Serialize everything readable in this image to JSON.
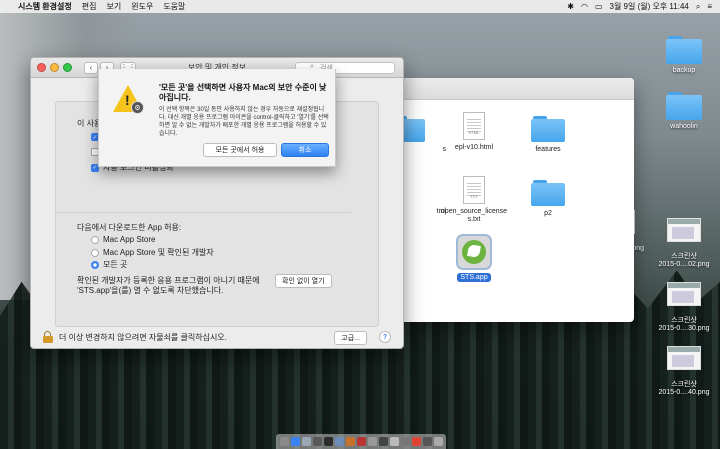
{
  "menubar": {
    "app_name": "시스템 환경설정",
    "items": [
      "편집",
      "보기",
      "윈도우",
      "도움말"
    ],
    "clock": "3월 9일 (월) 오후 11:44",
    "icons": [
      "apple-icon",
      "bluetooth-icon",
      "wifi-icon",
      "battery-icon",
      "spotlight-icon",
      "notification-icon"
    ]
  },
  "prefs": {
    "title": "보안 및 개인 정보",
    "search_placeholder": "검색",
    "option_row_partial": "이 사용자",
    "option_row_partial2": "자동 로그인 비활성화",
    "download_label": "다음에서 다운로드한 App 허용:",
    "radio_options": [
      "Mac App Store",
      "Mac App Store 및 확인된 개발자",
      "모든 곳"
    ],
    "selected_radio": 2,
    "blocked_text_line1": "확인된 개발자가 등록한 응용 프로그램이 아니기 때문에",
    "blocked_text_line2": "'STS.app'을(를) 열 수 없도록 차단했습니다.",
    "open_anyway_button": "확인 없이 열기",
    "lock_text": "더 이상 변경하지 않으려면 자물쇠를 클릭하십시오.",
    "advanced_button": "고급...",
    "help_button": "?"
  },
  "sheet": {
    "heading": "'모든 곳'을 선택하면 사용자 Mac의 보안 수준이 낮아집니다.",
    "message": "이 선택 항목은 30일 동안 사용하지 않는 경우 자동으로 재설정됩니다. 대신 개별 응용 프로그램 아이콘을 control-클릭하고 '열기'를 선택하면 알 수 없는 개발자가 배포한 개별 응용 프로그램을 허용할 수 있습니다.",
    "allow_button": "모든 곳에서 허용",
    "cancel_button": "취소"
  },
  "finder": {
    "files": [
      {
        "name": "s",
        "kind": "folder"
      },
      {
        "name": "epl-v10.html",
        "kind": "doc",
        "ext": "HTML"
      },
      {
        "name": "features",
        "kind": "folder"
      },
      {
        "name": "tml",
        "kind": "doc",
        "ext": ""
      },
      {
        "name": "open_source_licenses.txt",
        "kind": "doc",
        "ext": "TXT"
      },
      {
        "name": "p2",
        "kind": "folder"
      },
      {
        "name": "STS.app",
        "kind": "app"
      }
    ]
  },
  "desktop_icons": [
    {
      "name": "backup",
      "kind": "folder"
    },
    {
      "name": "wahoolin",
      "kind": "folder"
    },
    {
      "name": "스크린샷\n2015-0....02.png",
      "kind": "thumb"
    },
    {
      "name": "9.png",
      "kind": "thumb"
    },
    {
      "name": "스크린샷\n2015-0....30.png",
      "kind": "thumb"
    },
    {
      "name": "스크린샷\n2015-0....40.png",
      "kind": "thumb"
    }
  ],
  "dock_colors": [
    "#8b8b8b",
    "#3b82f6",
    "#9aa7b5",
    "#5a5a5a",
    "#2c2c2c",
    "#6b8db8",
    "#c8702a",
    "#b33",
    "#999",
    "#444",
    "#bbb",
    "#777",
    "#d43",
    "#555",
    "#aaa"
  ]
}
